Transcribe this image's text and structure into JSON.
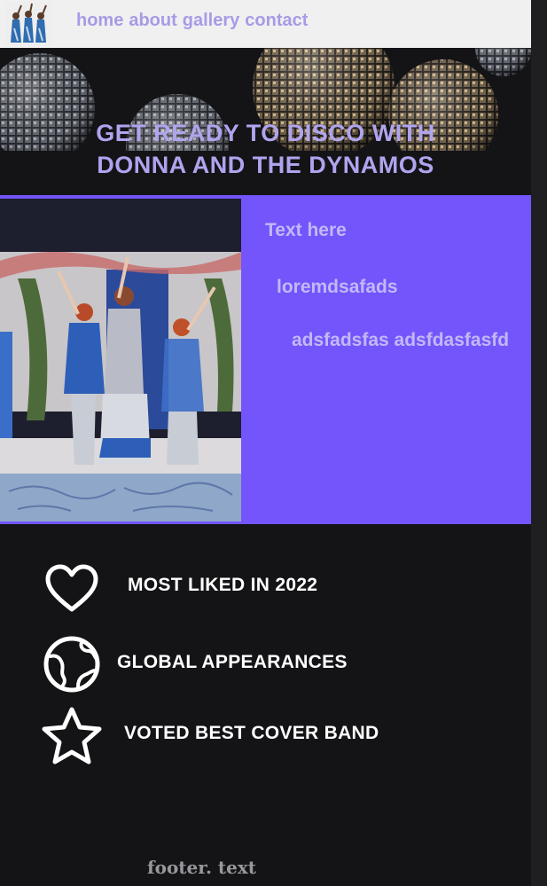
{
  "nav": {
    "links": [
      "home",
      "about",
      "gallery",
      "contact"
    ]
  },
  "hero": {
    "title_line1": "GET READY TO DISCO WITH",
    "title_line2": "DONNA AND THE DYNAMOS"
  },
  "feature": {
    "heading": "Text here",
    "line1": "loremdsafads",
    "line2": "adsfadsfas adsfdasfasfd"
  },
  "accolades": [
    {
      "icon": "heart-icon",
      "label": "MOST LIKED IN 2022"
    },
    {
      "icon": "globe-icon",
      "label": "GLOBAL APPEARANCES"
    },
    {
      "icon": "star-icon",
      "label": "VOTED BEST COVER BAND"
    }
  ],
  "footer": {
    "text": "footer. text"
  },
  "colors": {
    "accent": "#7355fb",
    "lavender_text": "#a79be6",
    "background": "#141417",
    "nav_bg": "#f0f0f1"
  }
}
